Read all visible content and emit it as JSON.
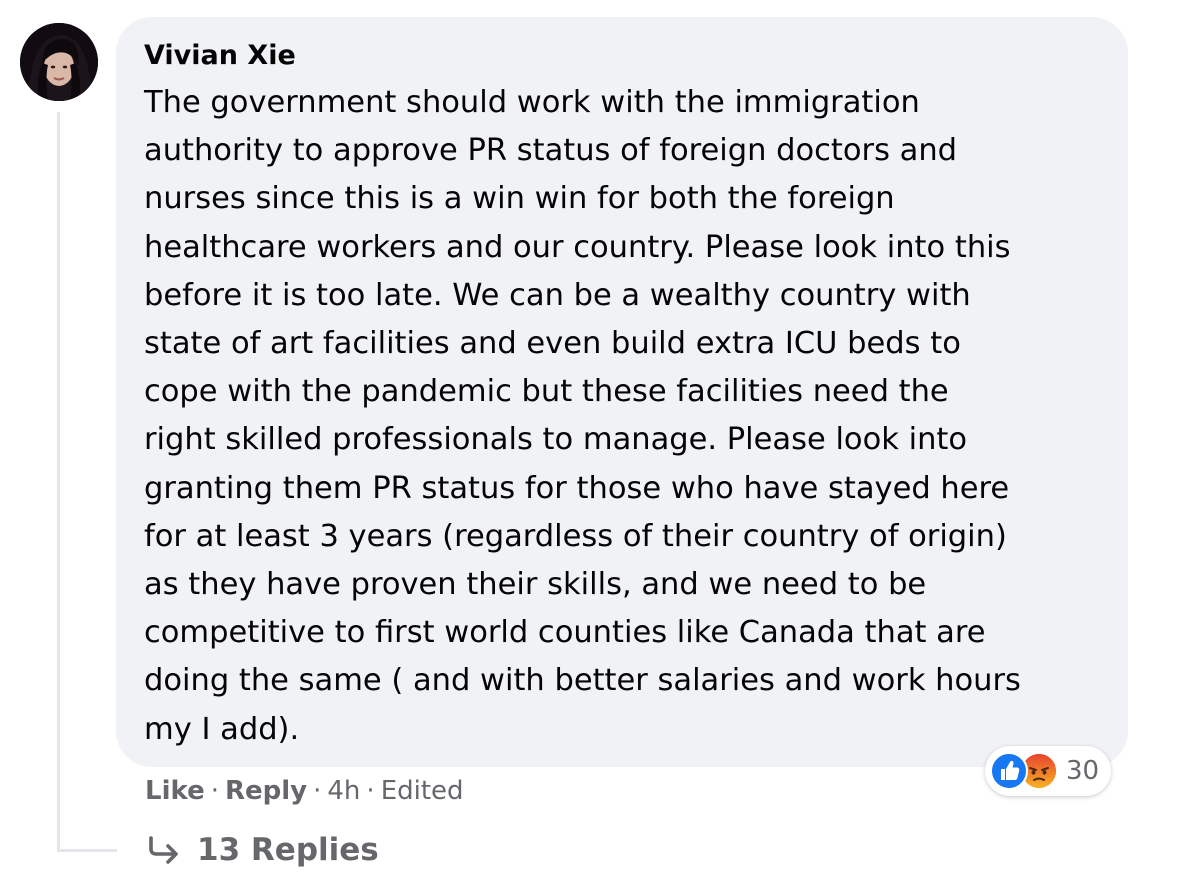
{
  "comment": {
    "author": "Vivian Xie",
    "text_lines": [
      "The government should work with the immigration",
      "authority to approve PR status of foreign doctors and",
      "nurses since this is a win win for both the foreign",
      "healthcare workers and our country. Please look into this",
      "before it is too late. We can be a wealthy country with",
      "state of art facilities and even build extra ICU beds to",
      "cope with the pandemic but these facilities need the",
      "right skilled professionals to manage. Please look into",
      "granting them PR status for those who have stayed here",
      "for at least 3 years (regardless of their country of origin)",
      "as they have proven their skills, and we need to be",
      "competitive to first world counties like Canada that are",
      "doing the same ( and with better salaries and work hours",
      "my I add)."
    ]
  },
  "reactions": {
    "icons": [
      "like-icon",
      "angry-icon"
    ],
    "count": "30",
    "colors": {
      "like": "#1877f2",
      "angry": "#f0762a"
    }
  },
  "actions": {
    "like_label": "Like",
    "reply_label": "Reply",
    "separator": "·",
    "time": "4h",
    "edited_label": "Edited"
  },
  "replies": {
    "icon": "reply-arrow-icon",
    "label": "13 Replies"
  },
  "colors": {
    "bubble_background": "#f0f2f5",
    "secondary_text": "#65676b",
    "primary_text": "#050505"
  }
}
